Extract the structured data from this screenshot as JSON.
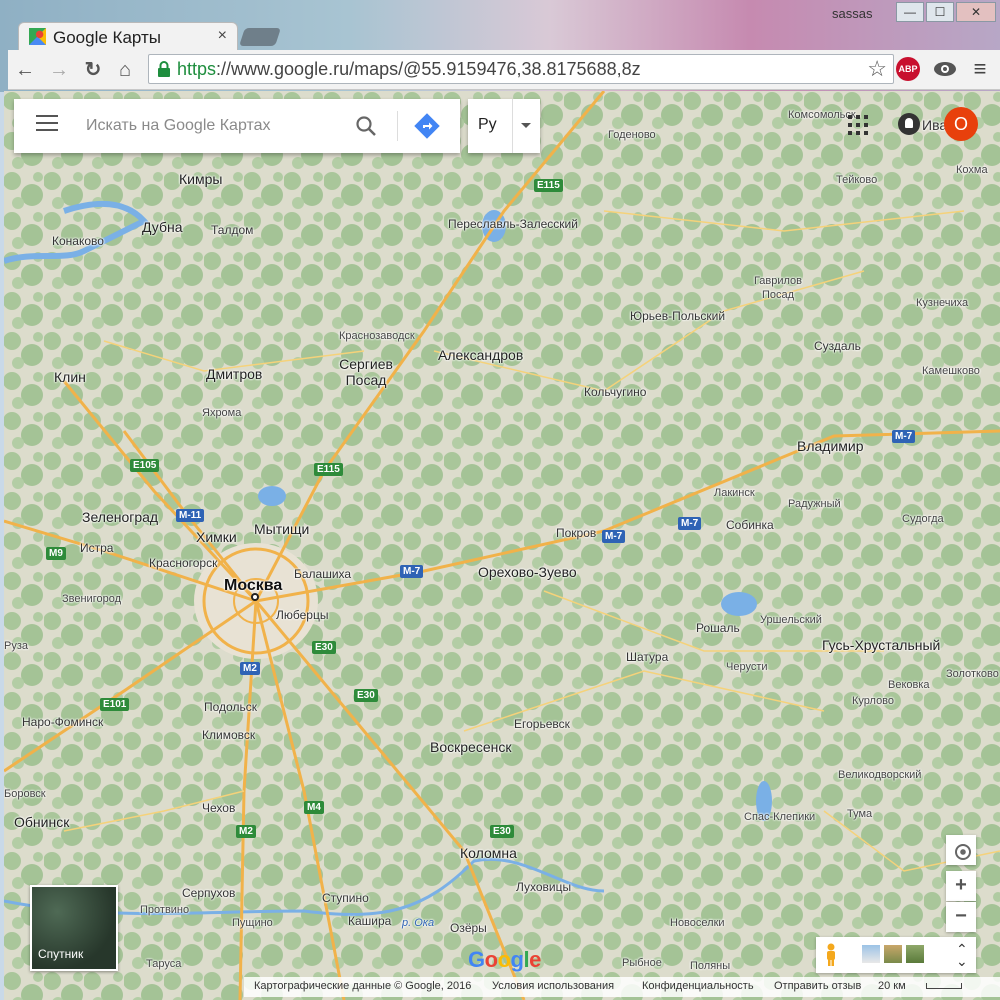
{
  "browser": {
    "tab_title": "Google Карты",
    "tab_close": "×",
    "profile_name": "sassas",
    "window_buttons": [
      "—",
      "☐",
      "✕"
    ],
    "url_scheme": "https",
    "url_rest": "://www.google.ru/maps/@55.9159476,38.8175688,8z",
    "abp_label": "ABP",
    "menu_icon": "≡"
  },
  "search": {
    "placeholder": "Искать на Google Картах",
    "language_label": "Ру"
  },
  "account": {
    "name_fragment": "Ива",
    "avatar_letter": "О"
  },
  "controls": {
    "zoom_in": "+",
    "zoom_out": "−",
    "satellite_label": "Спутник",
    "layers_chevrons": "⌃"
  },
  "map_labels": {
    "moscow": "Москва",
    "cities": [
      "Кимры",
      "Дубна",
      "Конаково",
      "Талдом",
      "Клин",
      "Дмитров",
      "Яхрома",
      "Сергиев Посад",
      "Краснозаводск",
      "Александров",
      "Переславль-Залесский",
      "Годеново",
      "Комсомольск",
      "Тейково",
      "Кохма",
      "Гаврилов Посад",
      "Юрьев-Польский",
      "Кузнечиха",
      "Суздаль",
      "Камешково",
      "Кольчугино",
      "Владимир",
      "Лакинск",
      "Радужный",
      "Собинка",
      "Судогда",
      "Покров",
      "Орехово-Зуево",
      "Балашиха",
      "Мытищи",
      "Химки",
      "Зеленоград",
      "Истра",
      "Красногорск",
      "Звенигород",
      "Люберцы",
      "Подольск",
      "Климовск",
      "Наро-Фоминск",
      "Обнинск",
      "Чехов",
      "Серпухов",
      "Протвино",
      "Пущино",
      "Таруса",
      "Кашира",
      "Ступино",
      "Озёры",
      "Коломна",
      "Луховицы",
      "Воскресенск",
      "Егорьевск",
      "Шатура",
      "Рошаль",
      "Черусти",
      "Уршельский",
      "Гусь-Хрустальный",
      "Золотково",
      "Вековка",
      "Курлово",
      "Великодворский",
      "Спас-Клепики",
      "Тума",
      "Новоселки",
      "Рыбное",
      "Поляны",
      "Боровск",
      "Руза"
    ],
    "river": "р. Ока"
  },
  "road_shields": {
    "green": [
      "E115",
      "E115",
      "E105",
      "E30",
      "E30",
      "E30",
      "E101",
      "M4",
      "M2",
      "M9"
    ],
    "blue": [
      "M-11",
      "M-7",
      "M-7",
      "M-7",
      "M-7",
      "M2"
    ]
  },
  "footer": {
    "copyright": "Картографические данные © Google, 2016",
    "terms": "Условия использования",
    "privacy": "Конфиденциальность",
    "feedback": "Отправить отзыв",
    "scale": "20 км"
  },
  "logo_text": "Google"
}
